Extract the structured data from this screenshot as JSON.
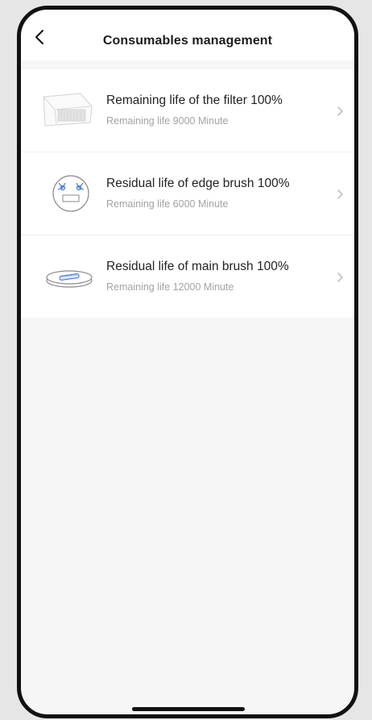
{
  "header": {
    "title": "Consumables management"
  },
  "icons": {
    "back": "chevron-left-icon",
    "chevron": "chevron-right-icon"
  },
  "items": [
    {
      "title": "Remaining life of the filter 100%",
      "subtitle": "Remaining life 9000 Minute",
      "icon": "filter-icon"
    },
    {
      "title": "Residual life of edge brush 100%",
      "subtitle": "Remaining life 6000 Minute",
      "icon": "edge-brush-icon"
    },
    {
      "title": "Residual life of main brush 100%",
      "subtitle": "Remaining life 12000 Minute",
      "icon": "main-brush-icon"
    }
  ],
  "colors": {
    "background": "#f6f6f6",
    "card": "#ffffff",
    "text": "#222222",
    "subtext": "#a3a3a3",
    "accent": "#3a6fd6"
  }
}
